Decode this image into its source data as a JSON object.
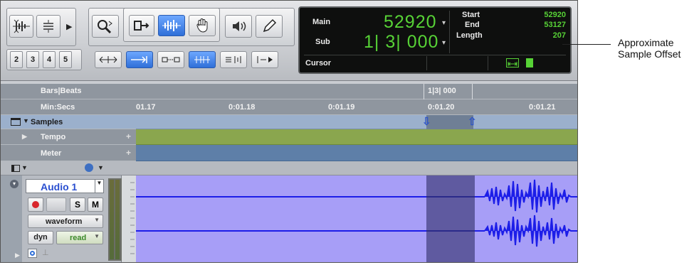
{
  "counter": {
    "main_label": "Main",
    "main_value": "52920",
    "sub_label": "Sub",
    "sub_value": "1| 3| 000",
    "cursor_label": "Cursor",
    "start_label": "Start",
    "start_value": "52920",
    "end_label": "End",
    "end_value": "53127",
    "length_label": "Length",
    "length_value": "207",
    "caret": "▾"
  },
  "toolbar": {
    "number_buttons": [
      "2",
      "3",
      "4",
      "5"
    ]
  },
  "annotation": {
    "line1": "Approximate",
    "line2": "Sample Offset"
  },
  "rulers": {
    "bars_label": "Bars|Beats",
    "bars_marker": "1|3| 000",
    "minsecs_label": "Min:Secs",
    "minsecs_ticks": [
      "01.17",
      "0:01.18",
      "0:01.19",
      "0:01.20",
      "0:01.21"
    ],
    "samples_label": "Samples",
    "tempo_label": "Tempo",
    "meter_label": "Meter",
    "plus": "+"
  },
  "track": {
    "name": "Audio 1",
    "record_label": "",
    "solo_label": "S",
    "mute_label": "M",
    "view_value": "waveform",
    "automation_type": "dyn",
    "automation_mode": "read"
  },
  "colors": {
    "counter_green": "#57d236",
    "tempo_green": "#8aa64e",
    "meter_blue": "#5e7fa8",
    "selection": "#5f5aa0",
    "waveform": "#1d1ee8",
    "accent_blue": "#2f6fd8"
  }
}
